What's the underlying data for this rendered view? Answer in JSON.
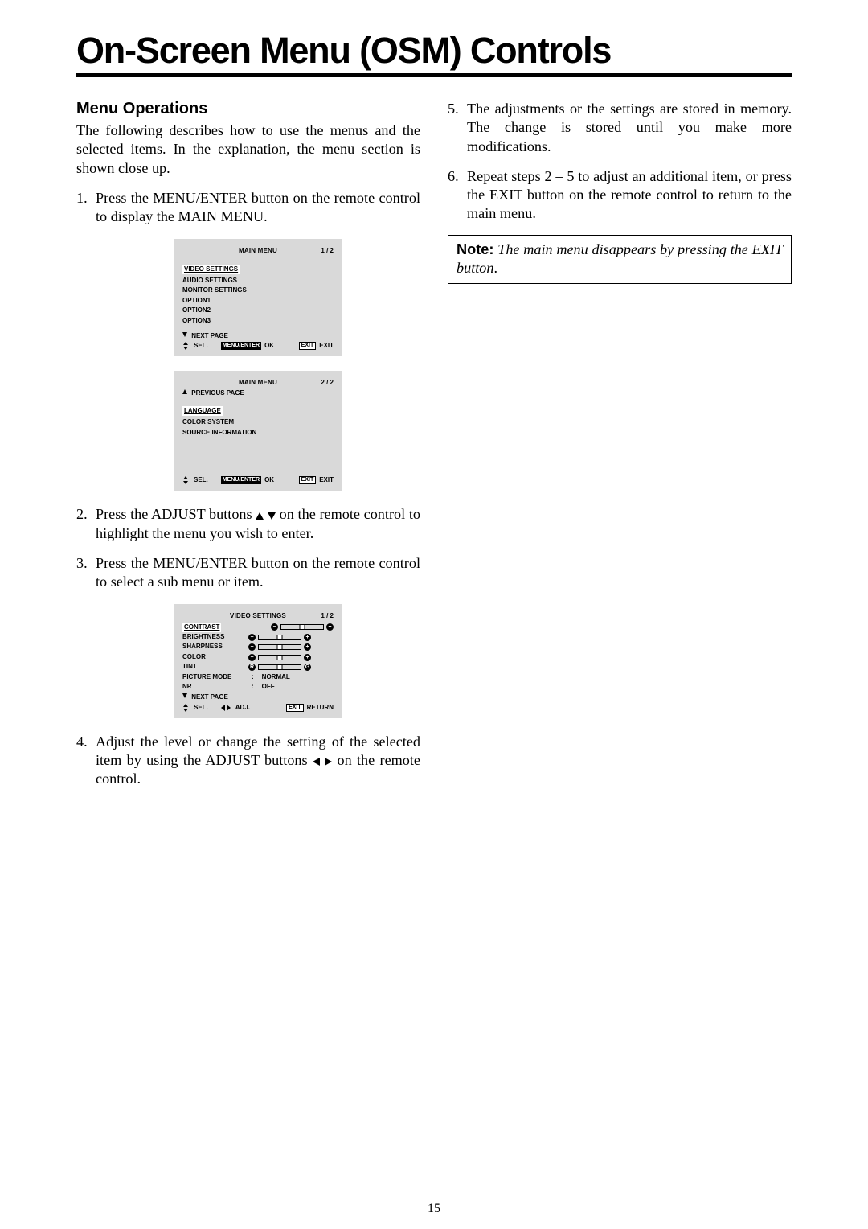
{
  "page_number": "15",
  "title": "On-Screen Menu (OSM) Controls",
  "left": {
    "heading": "Menu Operations",
    "intro": "The following describes how to use the menus and the selected items. In the explanation, the menu section is shown close up.",
    "step1": "Press the MENU/ENTER button on the remote control to display the MAIN MENU.",
    "step2_pre": "Press the ADJUST buttons ",
    "step2_post": " on the remote control to highlight the menu you wish to enter.",
    "step3": "Press the MENU/ENTER button on the remote control to select a sub menu or item.",
    "step4_pre": "Adjust the level or change the setting of the selected item by using the ADJUST buttons ",
    "step4_post": " on the remote control."
  },
  "right": {
    "step5": "The adjustments or the settings are stored in memory. The change is stored until you make more modifications.",
    "step6": "Repeat steps 2 – 5 to adjust an additional item, or press the EXIT button on the remote control to return to the main menu.",
    "note_label": "Note:",
    "note_text1": " The main menu disappears by pressing the EXIT button",
    "note_period": "."
  },
  "screen1": {
    "title": "MAIN MENU",
    "page": "1 / 2",
    "items": [
      "VIDEO SETTINGS",
      "AUDIO SETTINGS",
      "MONITOR SETTINGS",
      "OPTION1",
      "OPTION2",
      "OPTION3"
    ],
    "next": "NEXT PAGE",
    "sel": "SEL.",
    "menuenter": "MENU/ENTER",
    "ok": "OK",
    "exit_badge": "EXIT",
    "exit": "EXIT"
  },
  "screen2": {
    "title": "MAIN MENU",
    "page": "2 / 2",
    "prev": "PREVIOUS PAGE",
    "items": [
      "LANGUAGE",
      "COLOR SYSTEM",
      "SOURCE INFORMATION"
    ],
    "sel": "SEL.",
    "menuenter": "MENU/ENTER",
    "ok": "OK",
    "exit_badge": "EXIT",
    "exit": "EXIT"
  },
  "screen3": {
    "title": "VIDEO SETTINGS",
    "page": "1 / 2",
    "rows": {
      "contrast": "CONTRAST",
      "brightness": "BRIGHTNESS",
      "sharpness": "SHARPNESS",
      "color": "COLOR",
      "tint": "TINT",
      "picture_mode": "PICTURE MODE",
      "picture_mode_val": "NORMAL",
      "nr": "NR",
      "nr_val": "OFF",
      "next": "NEXT PAGE"
    },
    "sel": "SEL.",
    "adj": "ADJ.",
    "exit_badge": "EXIT",
    "return": "RETURN"
  }
}
